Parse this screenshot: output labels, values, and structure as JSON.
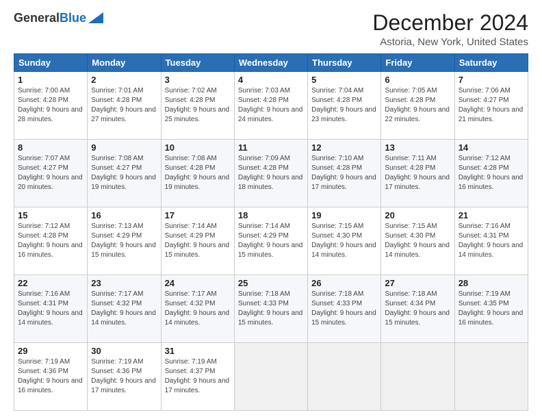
{
  "header": {
    "logo_general": "General",
    "logo_blue": "Blue",
    "title": "December 2024",
    "subtitle": "Astoria, New York, United States"
  },
  "days_of_week": [
    "Sunday",
    "Monday",
    "Tuesday",
    "Wednesday",
    "Thursday",
    "Friday",
    "Saturday"
  ],
  "weeks": [
    [
      {
        "day": "1",
        "sunrise": "7:00 AM",
        "sunset": "4:28 PM",
        "daylight": "9 hours and 28 minutes."
      },
      {
        "day": "2",
        "sunrise": "7:01 AM",
        "sunset": "4:28 PM",
        "daylight": "9 hours and 27 minutes."
      },
      {
        "day": "3",
        "sunrise": "7:02 AM",
        "sunset": "4:28 PM",
        "daylight": "9 hours and 25 minutes."
      },
      {
        "day": "4",
        "sunrise": "7:03 AM",
        "sunset": "4:28 PM",
        "daylight": "9 hours and 24 minutes."
      },
      {
        "day": "5",
        "sunrise": "7:04 AM",
        "sunset": "4:28 PM",
        "daylight": "9 hours and 23 minutes."
      },
      {
        "day": "6",
        "sunrise": "7:05 AM",
        "sunset": "4:28 PM",
        "daylight": "9 hours and 22 minutes."
      },
      {
        "day": "7",
        "sunrise": "7:06 AM",
        "sunset": "4:27 PM",
        "daylight": "9 hours and 21 minutes."
      }
    ],
    [
      {
        "day": "8",
        "sunrise": "7:07 AM",
        "sunset": "4:27 PM",
        "daylight": "9 hours and 20 minutes."
      },
      {
        "day": "9",
        "sunrise": "7:08 AM",
        "sunset": "4:27 PM",
        "daylight": "9 hours and 19 minutes."
      },
      {
        "day": "10",
        "sunrise": "7:08 AM",
        "sunset": "4:28 PM",
        "daylight": "9 hours and 19 minutes."
      },
      {
        "day": "11",
        "sunrise": "7:09 AM",
        "sunset": "4:28 PM",
        "daylight": "9 hours and 18 minutes."
      },
      {
        "day": "12",
        "sunrise": "7:10 AM",
        "sunset": "4:28 PM",
        "daylight": "9 hours and 17 minutes."
      },
      {
        "day": "13",
        "sunrise": "7:11 AM",
        "sunset": "4:28 PM",
        "daylight": "9 hours and 17 minutes."
      },
      {
        "day": "14",
        "sunrise": "7:12 AM",
        "sunset": "4:28 PM",
        "daylight": "9 hours and 16 minutes."
      }
    ],
    [
      {
        "day": "15",
        "sunrise": "7:12 AM",
        "sunset": "4:28 PM",
        "daylight": "9 hours and 16 minutes."
      },
      {
        "day": "16",
        "sunrise": "7:13 AM",
        "sunset": "4:29 PM",
        "daylight": "9 hours and 15 minutes."
      },
      {
        "day": "17",
        "sunrise": "7:14 AM",
        "sunset": "4:29 PM",
        "daylight": "9 hours and 15 minutes."
      },
      {
        "day": "18",
        "sunrise": "7:14 AM",
        "sunset": "4:29 PM",
        "daylight": "9 hours and 15 minutes."
      },
      {
        "day": "19",
        "sunrise": "7:15 AM",
        "sunset": "4:30 PM",
        "daylight": "9 hours and 14 minutes."
      },
      {
        "day": "20",
        "sunrise": "7:15 AM",
        "sunset": "4:30 PM",
        "daylight": "9 hours and 14 minutes."
      },
      {
        "day": "21",
        "sunrise": "7:16 AM",
        "sunset": "4:31 PM",
        "daylight": "9 hours and 14 minutes."
      }
    ],
    [
      {
        "day": "22",
        "sunrise": "7:16 AM",
        "sunset": "4:31 PM",
        "daylight": "9 hours and 14 minutes."
      },
      {
        "day": "23",
        "sunrise": "7:17 AM",
        "sunset": "4:32 PM",
        "daylight": "9 hours and 14 minutes."
      },
      {
        "day": "24",
        "sunrise": "7:17 AM",
        "sunset": "4:32 PM",
        "daylight": "9 hours and 14 minutes."
      },
      {
        "day": "25",
        "sunrise": "7:18 AM",
        "sunset": "4:33 PM",
        "daylight": "9 hours and 15 minutes."
      },
      {
        "day": "26",
        "sunrise": "7:18 AM",
        "sunset": "4:33 PM",
        "daylight": "9 hours and 15 minutes."
      },
      {
        "day": "27",
        "sunrise": "7:18 AM",
        "sunset": "4:34 PM",
        "daylight": "9 hours and 15 minutes."
      },
      {
        "day": "28",
        "sunrise": "7:19 AM",
        "sunset": "4:35 PM",
        "daylight": "9 hours and 16 minutes."
      }
    ],
    [
      {
        "day": "29",
        "sunrise": "7:19 AM",
        "sunset": "4:36 PM",
        "daylight": "9 hours and 16 minutes."
      },
      {
        "day": "30",
        "sunrise": "7:19 AM",
        "sunset": "4:36 PM",
        "daylight": "9 hours and 17 minutes."
      },
      {
        "day": "31",
        "sunrise": "7:19 AM",
        "sunset": "4:37 PM",
        "daylight": "9 hours and 17 minutes."
      },
      null,
      null,
      null,
      null
    ]
  ],
  "labels": {
    "sunrise": "Sunrise:",
    "sunset": "Sunset:",
    "daylight": "Daylight:"
  }
}
